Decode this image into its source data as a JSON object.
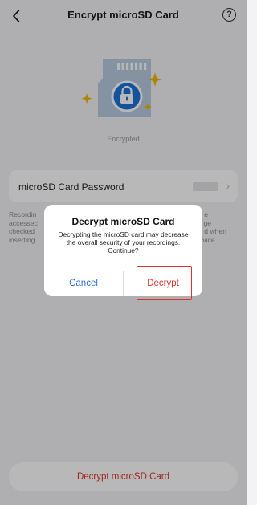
{
  "header": {
    "title": "Encrypt microSD Card",
    "back_icon": "chevron-left-icon",
    "help_label": "?"
  },
  "card": {
    "status": "Encrypted",
    "icon": "sd-card-lock-icon",
    "card_color": "#b9cbe0",
    "badge_color": "#1a73d9",
    "sparkle_color": "#f2b705"
  },
  "password_row": {
    "label": "microSD Card Password",
    "chevron": "›"
  },
  "description": {
    "line1": "Recordin",
    "line1_end": "e",
    "line2": "accessec",
    "line2_end": "ge",
    "line3": "checked",
    "line3_end": "d when",
    "line4": "inserting",
    "line4_end": "evice."
  },
  "bottom_button": {
    "label": "Decrypt microSD Card"
  },
  "dialog": {
    "title": "Decrypt microSD Card",
    "message": "Decrypting the microSD card may decrease the overall security of your recordings. Continue?",
    "cancel_label": "Cancel",
    "confirm_label": "Decrypt"
  },
  "colors": {
    "accent_blue": "#2f6fd6",
    "danger_red": "#e0312b"
  }
}
